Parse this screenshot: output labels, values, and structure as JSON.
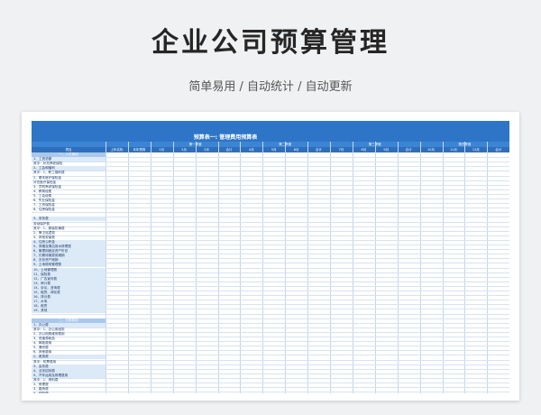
{
  "page": {
    "title": "企业公司预算管理",
    "subtitle": "简单易用 / 自动统计 / 自动更新"
  },
  "sheet": {
    "title": "预算表一: 管理费用预算表",
    "item_header": "项目",
    "quarters": [
      "第一季度",
      "第二季度",
      "第三季度",
      "第四季度"
    ],
    "columns": [
      "上年实际",
      "本年预算",
      "1月",
      "2月",
      "3月",
      "合计",
      "4月",
      "5月",
      "6月",
      "合计",
      "7月",
      "8月",
      "9月",
      "合计",
      "10月",
      "11月",
      "12月",
      "合计"
    ],
    "rows": [
      {
        "label": "一、人员费用",
        "type": "section"
      },
      {
        "label": "1、工资总额",
        "type": "shade"
      },
      {
        "label": "其中：补充养老保险",
        "type": "normal"
      },
      {
        "label": "2、工会和福利",
        "type": "shade"
      },
      {
        "label": "其中：1、职工福利费",
        "type": "normal"
      },
      {
        "label": "2、基本医疗保险金",
        "type": "normal"
      },
      {
        "label": "补充医疗保险金",
        "type": "normal"
      },
      {
        "label": "3、员购养老保险金",
        "type": "normal"
      },
      {
        "label": "4、教育经费",
        "type": "normal"
      },
      {
        "label": "5、工会经费",
        "type": "normal"
      },
      {
        "label": "6、失业保险金",
        "type": "normal"
      },
      {
        "label": "7、工伤保险金",
        "type": "normal"
      },
      {
        "label": "8、住房保险金",
        "type": "normal"
      },
      {
        "label": "",
        "type": "normal"
      },
      {
        "label": "3、劳务费",
        "type": "shade"
      },
      {
        "label": "劳动保护费",
        "type": "normal"
      },
      {
        "label": "其中：1、服装防暑费",
        "type": "normal"
      },
      {
        "label": "2、警卫巡逻费",
        "type": "normal"
      },
      {
        "label": "3、其他劳保费",
        "type": "normal"
      },
      {
        "label": "4、住房公积金",
        "type": "shade"
      },
      {
        "label": "5、采暖及清洁用水修理费",
        "type": "shade"
      },
      {
        "label": "6、管理用固定资产折旧",
        "type": "shade"
      },
      {
        "label": "7、长期待摊费用摊销",
        "type": "shade"
      },
      {
        "label": "8、无形资产摊销",
        "type": "shade"
      },
      {
        "label": "9、土地使用管理费",
        "type": "shade"
      },
      {
        "label": "10、土地管理费",
        "type": "shade"
      },
      {
        "label": "11、保险费",
        "type": "shade"
      },
      {
        "label": "12、广告宣传费",
        "type": "shade"
      },
      {
        "label": "13、审计费",
        "type": "shade"
      },
      {
        "label": "14、诉讼、咨询费",
        "type": "shade"
      },
      {
        "label": "15、租赁、绿化费",
        "type": "shade"
      },
      {
        "label": "16、排污费",
        "type": "shade"
      },
      {
        "label": "17、水电",
        "type": "shade"
      },
      {
        "label": "18、租赁",
        "type": "shade"
      },
      {
        "label": "19、其他",
        "type": "shade"
      },
      {
        "label": "",
        "type": "normal"
      },
      {
        "label": "二、日常费用",
        "type": "section"
      },
      {
        "label": "1、办公费",
        "type": "shade"
      },
      {
        "label": "其中：1、办公用纸张",
        "type": "normal"
      },
      {
        "label": "2、办公用具维修费用",
        "type": "normal"
      },
      {
        "label": "3、低值易耗品",
        "type": "normal"
      },
      {
        "label": "4、邮政费用",
        "type": "normal"
      },
      {
        "label": "5、通讯费",
        "type": "normal"
      },
      {
        "label": "6、其他费用",
        "type": "normal"
      },
      {
        "label": "2、差旅费",
        "type": "shade"
      },
      {
        "label": "其中：机票费用",
        "type": "normal"
      },
      {
        "label": "3、会务费",
        "type": "shade"
      },
      {
        "label": "4、业务招待费",
        "type": "shade"
      },
      {
        "label": "5、汽车运用及修理费用",
        "type": "shade"
      },
      {
        "label": "其中：1、燃料费",
        "type": "normal"
      },
      {
        "label": "2、修理费",
        "type": "normal"
      },
      {
        "label": "3、路桥费",
        "type": "normal"
      },
      {
        "label": "4、保险费",
        "type": "normal"
      }
    ]
  }
}
